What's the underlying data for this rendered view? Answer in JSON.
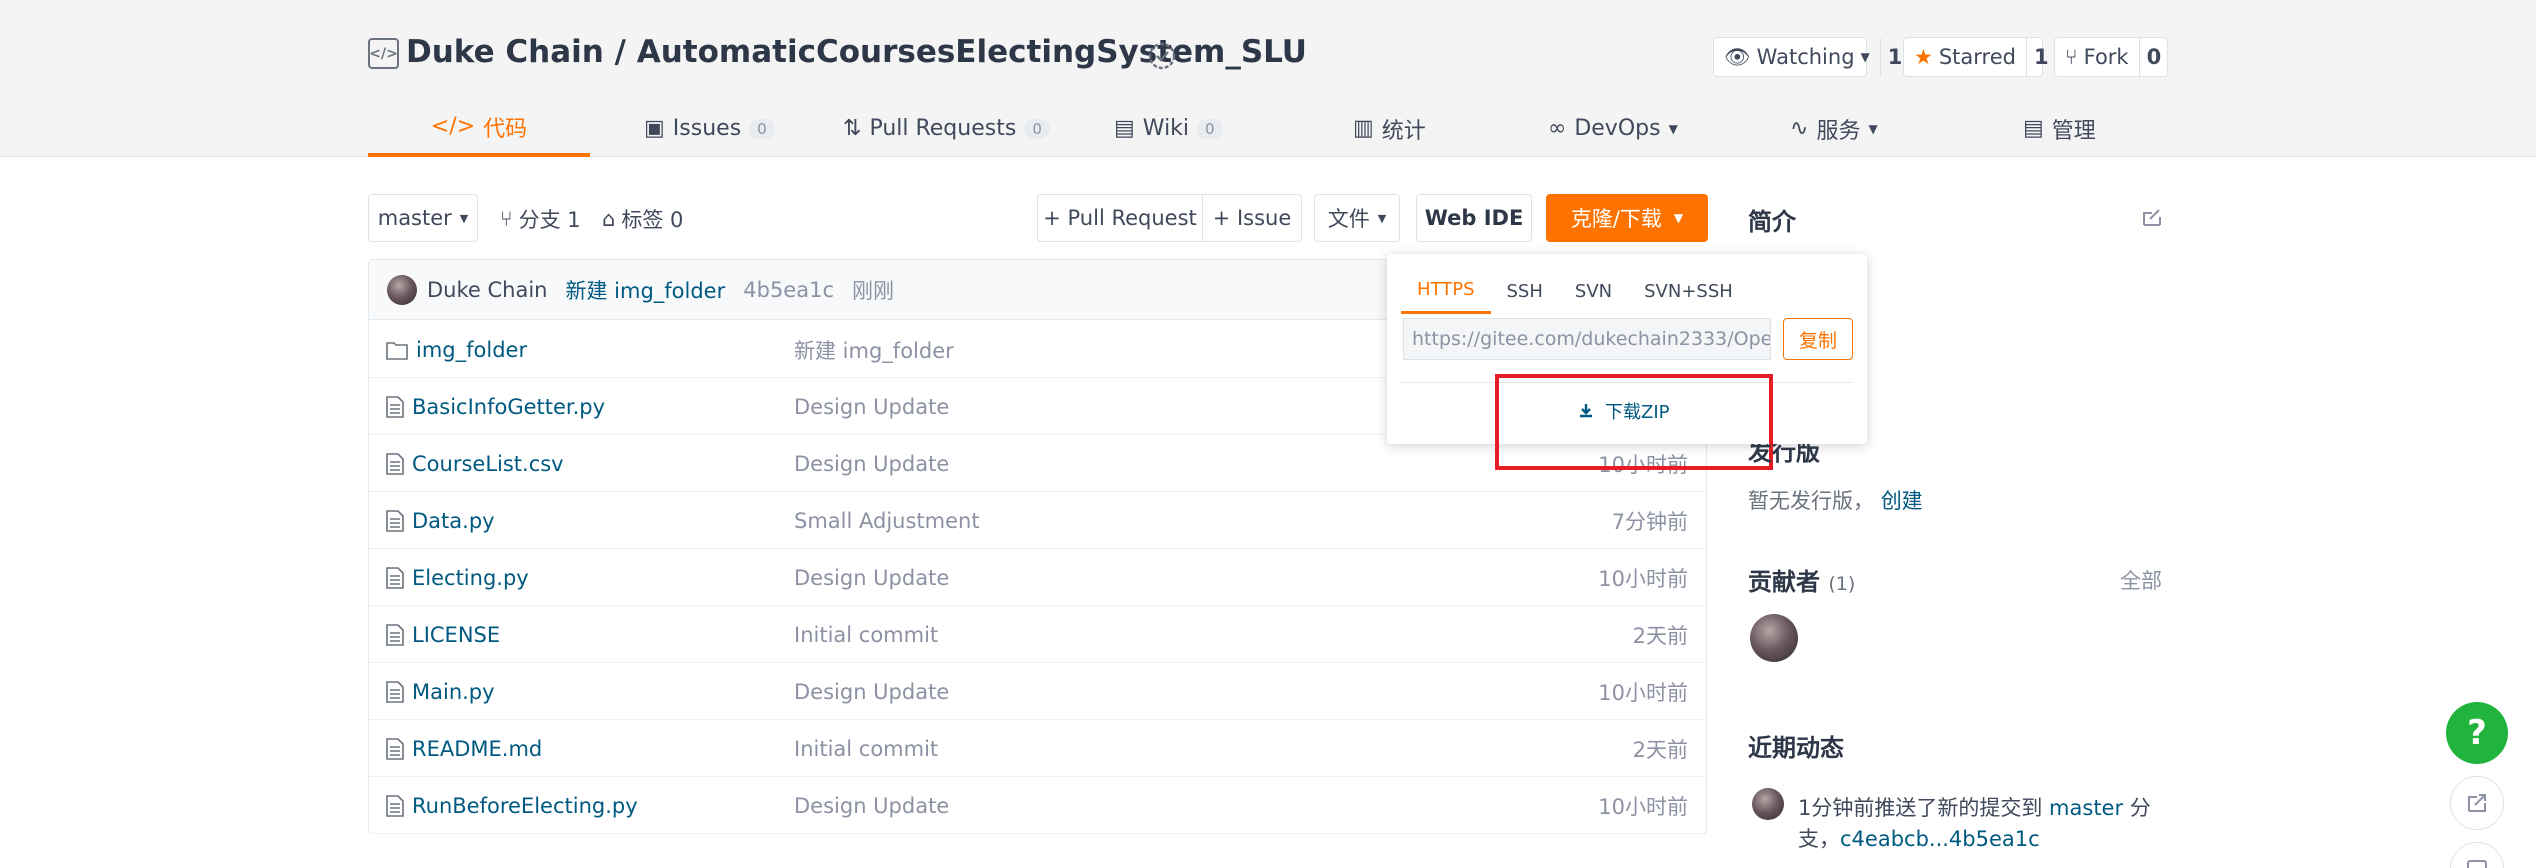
{
  "repo": {
    "title": "Duke Chain / AutomaticCoursesElectingSystem_SLU",
    "watch_label": "Watching",
    "watch_count": "1",
    "star_label": "Starred",
    "star_count": "1",
    "fork_label": "Fork",
    "fork_count": "0"
  },
  "tabs": [
    {
      "label": "代码",
      "icon": "code-icon"
    },
    {
      "label": "Issues",
      "count": "0",
      "icon": "issues-icon"
    },
    {
      "label": "Pull Requests",
      "count": "0",
      "icon": "pull-request-icon"
    },
    {
      "label": "Wiki",
      "count": "0",
      "icon": "book-icon"
    },
    {
      "label": "统计",
      "icon": "chart-icon"
    },
    {
      "label": "DevOps",
      "icon": "infinity-icon"
    },
    {
      "label": "服务",
      "icon": "pulse-icon"
    },
    {
      "label": "管理",
      "icon": "document-icon"
    }
  ],
  "toolbar": {
    "branch": "master",
    "branches_label": "分支 1",
    "tags_label": "标签 0",
    "pr_button": "+ Pull Request",
    "issue_button": "+ Issue",
    "file_button": "文件",
    "webide_button": "Web IDE",
    "clone_button": "克隆/下载"
  },
  "commit": {
    "author": "Duke Chain",
    "message": "新建 img_folder",
    "hash": "4b5ea1c",
    "time": "刚刚"
  },
  "files": [
    {
      "name": "img_folder",
      "type": "folder",
      "message": "新建 img_folder",
      "time": ""
    },
    {
      "name": "BasicInfoGetter.py",
      "type": "file",
      "message": "Design Update",
      "time": ""
    },
    {
      "name": "CourseList.csv",
      "type": "file",
      "message": "Design Update",
      "time": "10小时前"
    },
    {
      "name": "Data.py",
      "type": "file",
      "message": "Small Adjustment",
      "time": "7分钟前"
    },
    {
      "name": "Electing.py",
      "type": "file",
      "message": "Design Update",
      "time": "10小时前"
    },
    {
      "name": "LICENSE",
      "type": "file",
      "message": "Initial commit",
      "time": "2天前"
    },
    {
      "name": "Main.py",
      "type": "file",
      "message": "Design Update",
      "time": "10小时前"
    },
    {
      "name": "README.md",
      "type": "file",
      "message": "Initial commit",
      "time": "2天前"
    },
    {
      "name": "RunBeforeElecting.py",
      "type": "file",
      "message": "Design Update",
      "time": "10小时前"
    }
  ],
  "clone_dropdown": {
    "tabs": [
      "HTTPS",
      "SSH",
      "SVN",
      "SVN+SSH"
    ],
    "active_tab": "HTTPS",
    "url": "https://gitee.com/dukechain2333/Ope",
    "copy_label": "复制",
    "zip_label": "下载ZIP"
  },
  "sidebar": {
    "intro_title": "简介",
    "release_title_fragment": "发行版",
    "release_text": "暂无发行版，",
    "release_link": "创建",
    "contributors_title": "贡献者",
    "contributors_count": "(1)",
    "contributors_all": "全部",
    "activity_title": "近期动态",
    "activity_line1_text": "1分钟前推送了新的提交到 ",
    "activity_line1_branch": "master",
    "activity_line1_suffix": " 分",
    "activity_line2_prefix": "支，",
    "activity_line2_link": "c4eabcb...4b5ea1c"
  },
  "colors": {
    "accent": "#fe7300",
    "link": "#005980",
    "highlight": "#e81c24",
    "help": "#20b43c"
  }
}
